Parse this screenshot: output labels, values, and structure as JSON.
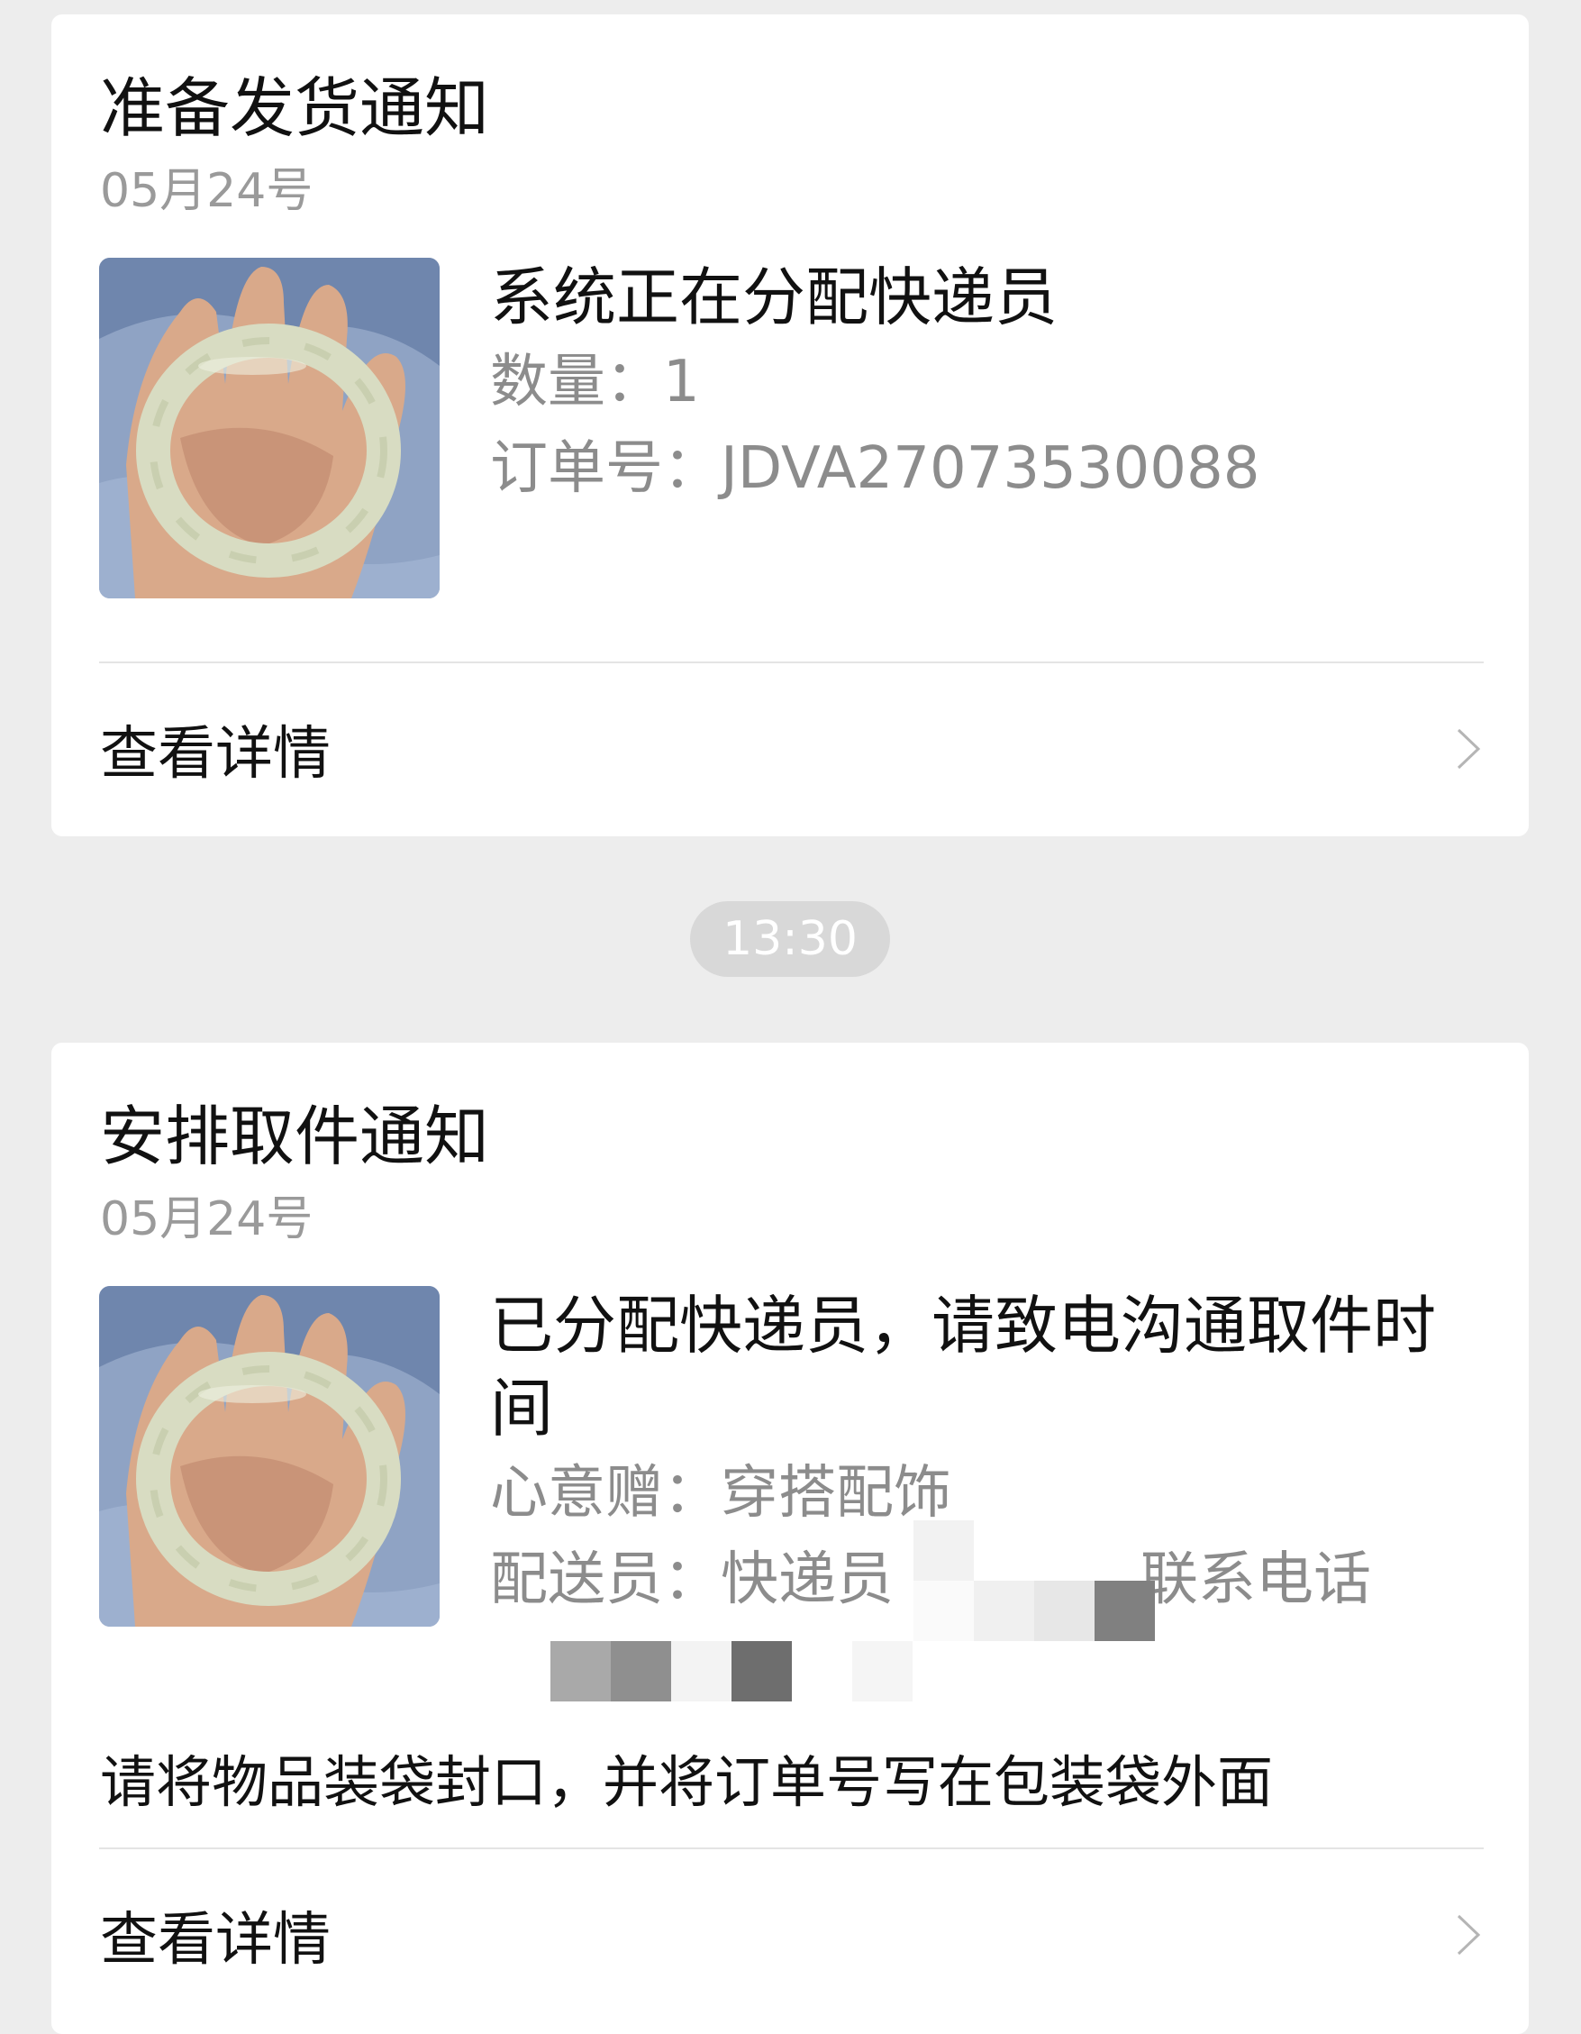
{
  "time_separator": "13:30",
  "cards": [
    {
      "title": "准备发货通知",
      "date": "05月24号",
      "image_alt": "jade-bangle-photo",
      "info_title": "系统正在分配快递员",
      "lines": [
        {
          "label": "数量：",
          "value": "1"
        },
        {
          "label": "订单号：",
          "value": "JDVA27073530088"
        }
      ],
      "detail_label": "查看详情"
    },
    {
      "title": "安排取件通知",
      "date": "05月24号",
      "image_alt": "jade-bangle-photo",
      "info_title": "已分配快递员，请致电沟通取件时间",
      "lines": [
        {
          "label": "心意赠：",
          "value": "穿搭配饰"
        },
        {
          "label": "配送员：",
          "value": "快递员",
          "suffix": "，联系电话"
        }
      ],
      "note": "请将物品装袋封口，并将订单号写在包装袋外面",
      "detail_label": "查看详情"
    }
  ],
  "icons": {
    "chevron": "chevron-right-icon"
  },
  "colors": {
    "background": "#ededed",
    "card": "#ffffff",
    "title_text": "#111111",
    "secondary_text": "#8c8c8c",
    "time_pill": "#d8d8d8"
  }
}
